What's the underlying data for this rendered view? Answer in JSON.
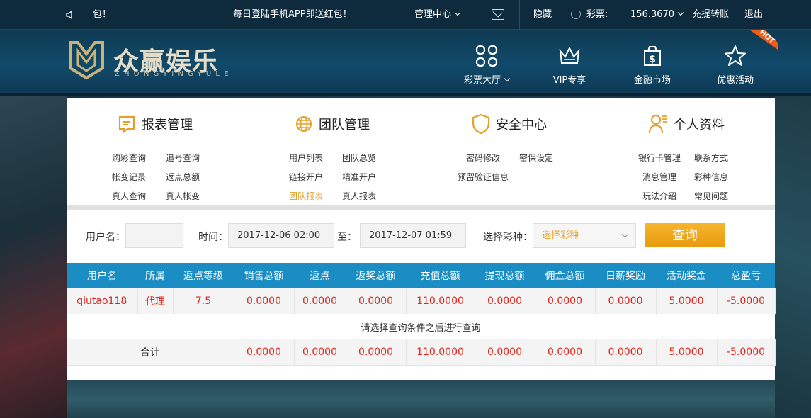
{
  "topbar": {
    "notice": "包！",
    "promo": "每日登陆手机APP即送红包！",
    "manage": "管理中心",
    "hide": "隐藏",
    "lottery_label": "彩票:",
    "balance": "156.3670",
    "deposit_transfer": "充提转账",
    "logout": "退出"
  },
  "brand": {
    "name": "众赢娱乐",
    "pinyin": "ZHONGYINGYULE"
  },
  "nav": [
    {
      "label": "彩票大厅",
      "icon": "grid-icon"
    },
    {
      "label": "VIP专享",
      "icon": "crown-icon"
    },
    {
      "label": "金融市场",
      "icon": "money-bag-icon"
    },
    {
      "label": "优惠活动",
      "icon": "star-icon",
      "badge": "HOT"
    }
  ],
  "menus": [
    {
      "title": "报表管理",
      "icon": "report-icon",
      "links": [
        "购彩查询",
        "追号查询",
        "帐变记录",
        "返点总额",
        "真人查询",
        "真人帐变"
      ]
    },
    {
      "title": "团队管理",
      "icon": "globe-icon",
      "links": [
        "用户列表",
        "团队总览",
        "链接开户",
        "精准开户",
        "团队报表",
        "真人报表"
      ]
    },
    {
      "title": "安全中心",
      "icon": "shield-icon",
      "links": [
        "密码修改",
        "密保设定",
        "预留验证信息"
      ]
    },
    {
      "title": "个人资料",
      "icon": "user-icon",
      "links": [
        "银行卡管理",
        "联系方式",
        "消息管理",
        "彩种信息",
        "玩法介绍",
        "常见问题"
      ]
    }
  ],
  "filter": {
    "username_label": "用户名：",
    "username_value": "",
    "time_label": "时间：",
    "start": "2017-12-06 02:00",
    "to_label": "至：",
    "end": "2017-12-07 01:59",
    "lottery_label": "选择彩种：",
    "lottery_value": "选择彩种",
    "query": "查询"
  },
  "table": {
    "headers": [
      "用户名",
      "所属",
      "返点等级",
      "销售总额",
      "返点",
      "返奖总额",
      "充值总额",
      "提现总额",
      "佣金总额",
      "日薪奖励",
      "活动奖金",
      "总盈亏"
    ],
    "row": [
      "qiutao118",
      "代理",
      "7.5",
      "0.0000",
      "0.0000",
      "0.0000",
      "110.0000",
      "0.0000",
      "0.0000",
      "0.0000",
      "5.0000",
      "-5.0000"
    ],
    "hint": "请选择查询条件之后进行查询",
    "total_label": "合计",
    "totals": [
      "0.0000",
      "0.0000",
      "0.0000",
      "110.0000",
      "0.0000",
      "0.0000",
      "0.0000",
      "5.0000",
      "-5.0000"
    ]
  },
  "colors": {
    "accent": "#e6a02a",
    "table_header": "#1a8ec4",
    "value_red": "#e0241b",
    "topbar": "#0d2b3d"
  }
}
